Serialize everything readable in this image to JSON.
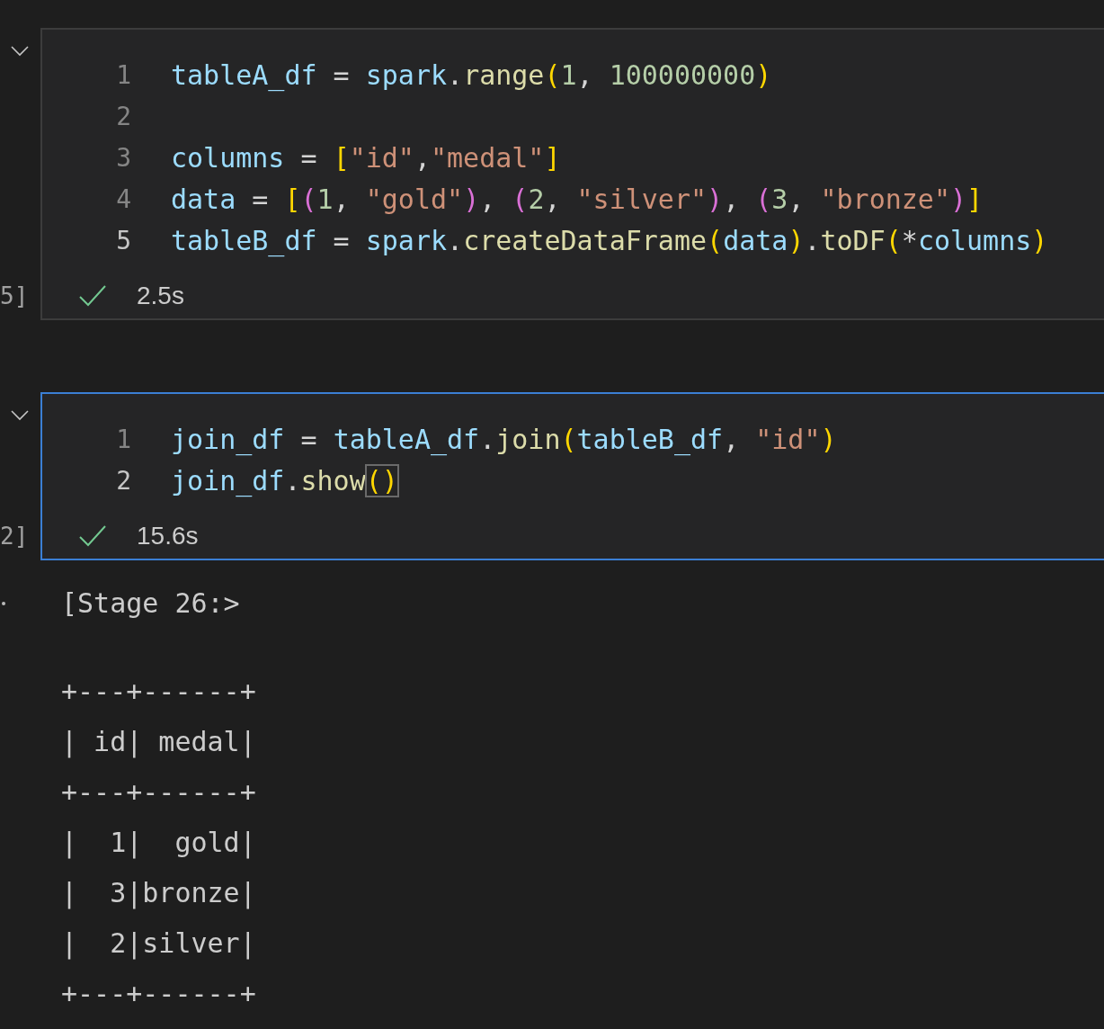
{
  "cells": [
    {
      "expanded": true,
      "selected": false,
      "execution_count": "5]",
      "lines": [
        {
          "number": "1",
          "active": false,
          "tokens": [
            {
              "kind": "var",
              "text": "tableA_df"
            },
            {
              "kind": "plain",
              "text": " = "
            },
            {
              "kind": "var",
              "text": "spark"
            },
            {
              "kind": "plain",
              "text": "."
            },
            {
              "kind": "fn",
              "text": "range"
            },
            {
              "kind": "b1",
              "text": "("
            },
            {
              "kind": "num",
              "text": "1"
            },
            {
              "kind": "plain",
              "text": ", "
            },
            {
              "kind": "num",
              "text": "100000000"
            },
            {
              "kind": "b1",
              "text": ")"
            }
          ]
        },
        {
          "number": "2",
          "active": false
        },
        {
          "number": "3",
          "active": false,
          "tokens": [
            {
              "kind": "var",
              "text": "columns"
            },
            {
              "kind": "plain",
              "text": " = "
            },
            {
              "kind": "b1",
              "text": "["
            },
            {
              "kind": "str",
              "text": "\"id\""
            },
            {
              "kind": "plain",
              "text": ","
            },
            {
              "kind": "str",
              "text": "\"medal\""
            },
            {
              "kind": "b1",
              "text": "]"
            }
          ]
        },
        {
          "number": "4",
          "active": false,
          "tokens": [
            {
              "kind": "var",
              "text": "data"
            },
            {
              "kind": "plain",
              "text": " = "
            },
            {
              "kind": "b1",
              "text": "["
            },
            {
              "kind": "b2",
              "text": "("
            },
            {
              "kind": "num",
              "text": "1"
            },
            {
              "kind": "plain",
              "text": ", "
            },
            {
              "kind": "str",
              "text": "\"gold\""
            },
            {
              "kind": "b2",
              "text": ")"
            },
            {
              "kind": "plain",
              "text": ", "
            },
            {
              "kind": "b2",
              "text": "("
            },
            {
              "kind": "num",
              "text": "2"
            },
            {
              "kind": "plain",
              "text": ", "
            },
            {
              "kind": "str",
              "text": "\"silver\""
            },
            {
              "kind": "b2",
              "text": ")"
            },
            {
              "kind": "plain",
              "text": ", "
            },
            {
              "kind": "b2",
              "text": "("
            },
            {
              "kind": "num",
              "text": "3"
            },
            {
              "kind": "plain",
              "text": ", "
            },
            {
              "kind": "str",
              "text": "\"bronze\""
            },
            {
              "kind": "b2",
              "text": ")"
            },
            {
              "kind": "b1",
              "text": "]"
            }
          ]
        },
        {
          "number": "5",
          "active": true,
          "tokens": [
            {
              "kind": "var",
              "text": "tableB_df"
            },
            {
              "kind": "plain",
              "text": " = "
            },
            {
              "kind": "var",
              "text": "spark"
            },
            {
              "kind": "plain",
              "text": "."
            },
            {
              "kind": "fn",
              "text": "createDataFrame"
            },
            {
              "kind": "b1",
              "text": "("
            },
            {
              "kind": "var",
              "text": "data"
            },
            {
              "kind": "b1",
              "text": ")"
            },
            {
              "kind": "plain",
              "text": "."
            },
            {
              "kind": "fn",
              "text": "toDF"
            },
            {
              "kind": "b1",
              "text": "("
            },
            {
              "kind": "plain",
              "text": "*"
            },
            {
              "kind": "var",
              "text": "columns"
            },
            {
              "kind": "b1",
              "text": ")"
            }
          ]
        }
      ],
      "status": {
        "success": true,
        "time": "2.5s"
      }
    },
    {
      "expanded": true,
      "selected": true,
      "execution_count": "2]",
      "lines": [
        {
          "number": "1",
          "active": false,
          "tokens": [
            {
              "kind": "var",
              "text": "join_df"
            },
            {
              "kind": "plain",
              "text": " = "
            },
            {
              "kind": "var",
              "text": "tableA_df"
            },
            {
              "kind": "plain",
              "text": "."
            },
            {
              "kind": "fn",
              "text": "join"
            },
            {
              "kind": "b1",
              "text": "("
            },
            {
              "kind": "var",
              "text": "tableB_df"
            },
            {
              "kind": "plain",
              "text": ", "
            },
            {
              "kind": "str",
              "text": "\"id\""
            },
            {
              "kind": "b1",
              "text": ")"
            }
          ]
        },
        {
          "number": "2",
          "active": true,
          "tokens": [
            {
              "kind": "var",
              "text": "join_df"
            },
            {
              "kind": "plain",
              "text": "."
            },
            {
              "kind": "fn",
              "text": "show"
            },
            {
              "kind": "match",
              "text": "()"
            }
          ]
        }
      ],
      "status": {
        "success": true,
        "time": "15.6s"
      }
    }
  ],
  "output": {
    "progress": "[Stage 26:>",
    "table_lines": [
      "+---+------+",
      "| id| medal|",
      "+---+------+",
      "|  1|  gold|",
      "|  3|bronze|",
      "|  2|silver|",
      "+---+------+"
    ]
  }
}
